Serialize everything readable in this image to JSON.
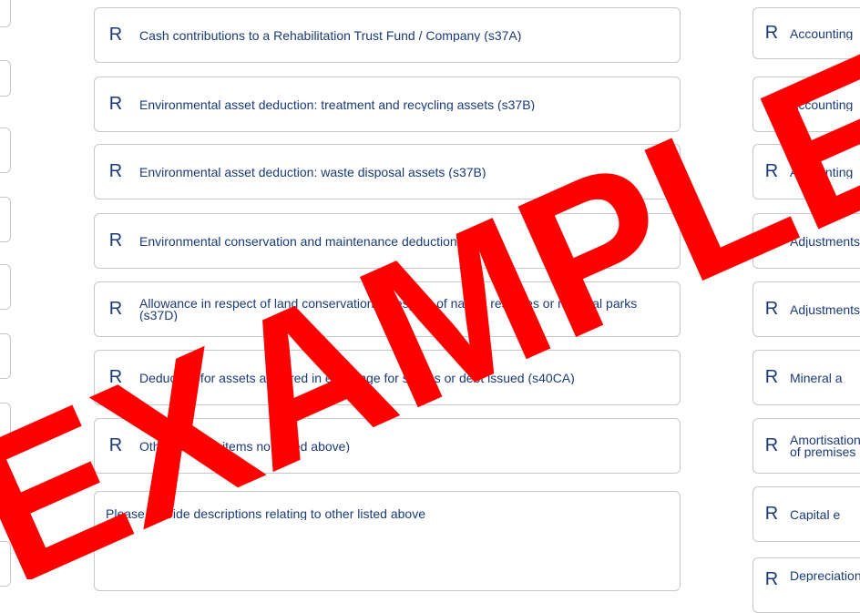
{
  "currency_symbol": "R",
  "left_column": {
    "items": [
      {
        "label": "Cash contributions to a Rehabilitation Trust Fund / Company (s37A)"
      },
      {
        "label": "Environmental asset deduction: treatment and recycling assets (s37B)"
      },
      {
        "label": "Environmental asset deduction: waste disposal assets (s37B)"
      },
      {
        "label": "Environmental conservation and maintenance deduction (s37C)"
      },
      {
        "label": "Allowance in respect of land conservation in respect of nature reserves or national parks (s37D)"
      },
      {
        "label": "Deduction for assets acquired in exchange for shares or debt issued (s40CA)"
      },
      {
        "label": "Other (specify items not listed above)"
      }
    ],
    "description_box": {
      "label": "Please provide descriptions relating to other listed above"
    }
  },
  "right_column": {
    "items": [
      {
        "label": "Accounting"
      },
      {
        "label": "Accounting"
      },
      {
        "label": "Accounting"
      },
      {
        "label": "Adjustments"
      },
      {
        "label": "Adjustments"
      },
      {
        "label": "Mineral a"
      },
      {
        "label": "Amortisation of premises"
      },
      {
        "label": "Capital e"
      },
      {
        "label": "Depreciation"
      }
    ]
  },
  "watermark": {
    "text": "EXAMPLE",
    "color": "#ff0000"
  }
}
